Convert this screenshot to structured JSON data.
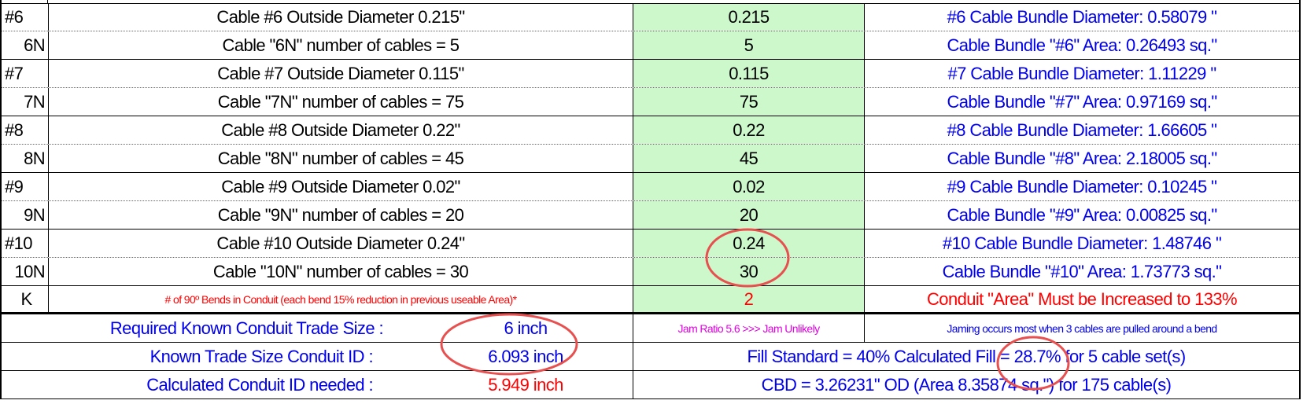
{
  "cable_rows": [
    {
      "id": "#6",
      "label": "Cable #6 Outside Diameter 0.215\"",
      "value": "0.215",
      "result": "#6 Cable Bundle Diameter: 0.58079 \""
    },
    {
      "id": "6N",
      "label": "Cable \"6N\" number of cables = 5",
      "value": "5",
      "result": "Cable Bundle \"#6\" Area: 0.26493 sq.\""
    },
    {
      "id": "#7",
      "label": "Cable #7 Outside Diameter 0.115\"",
      "value": "0.115",
      "result": "#7 Cable Bundle Diameter: 1.11229 \""
    },
    {
      "id": "7N",
      "label": "Cable \"7N\" number of cables = 75",
      "value": "75",
      "result": "Cable Bundle \"#7\" Area: 0.97169 sq.\""
    },
    {
      "id": "#8",
      "label": "Cable #8 Outside Diameter 0.22\"",
      "value": "0.22",
      "result": "#8 Cable Bundle Diameter: 1.66605 \""
    },
    {
      "id": "8N",
      "label": "Cable \"8N\" number of cables = 45",
      "value": "45",
      "result": "Cable Bundle \"#8\" Area: 2.18005 sq.\""
    },
    {
      "id": "#9",
      "label": "Cable #9 Outside Diameter 0.02\"",
      "value": "0.02",
      "result": "#9 Cable Bundle Diameter: 0.10245 \""
    },
    {
      "id": "9N",
      "label": "Cable \"9N\" number of cables = 20",
      "value": "20",
      "result": "Cable Bundle \"#9\" Area: 0.00825 sq.\""
    },
    {
      "id": "#10",
      "label": "Cable #10 Outside Diameter 0.24\"",
      "value": "0.24",
      "result": "#10 Cable Bundle Diameter: 1.48746 \""
    },
    {
      "id": "10N",
      "label": "Cable \"10N\" number of cables = 30",
      "value": "30",
      "result": "Cable Bundle \"#10\" Area: 1.73773 sq.\""
    }
  ],
  "bends": {
    "id": "K",
    "label": "# of 90º Bends in Conduit (each bend 15% reduction in previous useable Area)*",
    "value": "2",
    "result": "Conduit \"Area\" Must be Increased to 133%"
  },
  "summary": {
    "trade_size_label": "Required Known Conduit Trade Size :",
    "trade_size_value": "6 inch",
    "jam_ratio": "Jam Ratio 5.6 >>> Jam Unlikely",
    "jam_note": "Jaming occurs most when 3 cables are pulled around a bend",
    "conduit_id_label": "Known Trade Size Conduit ID :",
    "conduit_id_value": "6.093 inch",
    "fill": "Fill Standard = 40% Calculated Fill = 28.7% for 5 cable set(s)",
    "calc_id_label": "Calculated Conduit ID needed :",
    "calc_id_value": "5.949 inch",
    "cbd": "CBD = 3.26231\" OD (Area 8.35874 sq.\") for 175 cable(s)"
  },
  "colors": {
    "input_bg": "#ccf8cc",
    "result_text": "#0000ee",
    "warning_text": "#ff0000",
    "note_text": "#e000e0",
    "annotation": "#e85050"
  }
}
